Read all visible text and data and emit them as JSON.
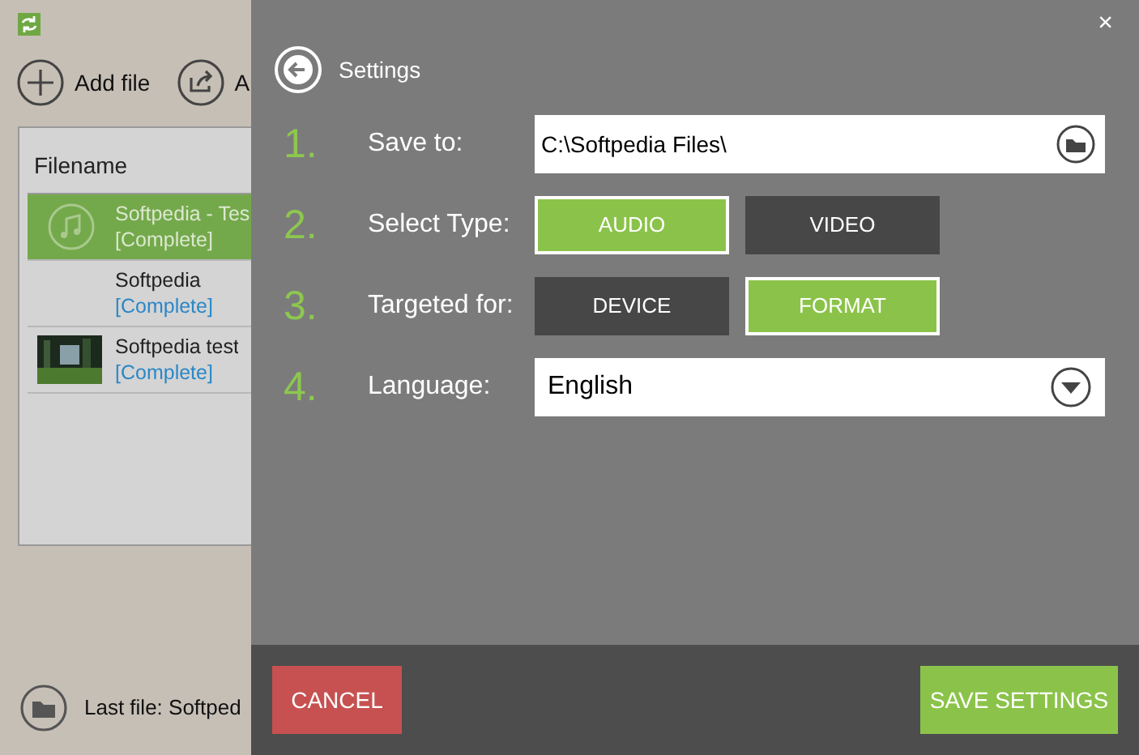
{
  "toolbar": {
    "add_file": "Add file",
    "second_action": "A"
  },
  "file_list": {
    "column": "Filename",
    "rows": [
      {
        "name": "Softpedia - Tes",
        "status": "[Complete]",
        "selected": true,
        "kind": "music"
      },
      {
        "name": "Softpedia",
        "status": "[Complete]",
        "selected": false,
        "kind": "blank"
      },
      {
        "name": "Softpedia test",
        "status": "[Complete]",
        "selected": false,
        "kind": "picture"
      }
    ]
  },
  "last_file": "Last file: Softped",
  "close": "×",
  "settings": {
    "title": "Settings",
    "save_to": {
      "number": "1.",
      "label": "Save to:",
      "value": "C:\\Softpedia Files\\"
    },
    "select_type": {
      "number": "2.",
      "label": "Select Type:",
      "options": [
        {
          "label": "AUDIO",
          "selected": true
        },
        {
          "label": "VIDEO",
          "selected": false
        }
      ]
    },
    "targeted_for": {
      "number": "3.",
      "label": "Targeted for:",
      "options": [
        {
          "label": "DEVICE",
          "selected": false
        },
        {
          "label": "FORMAT",
          "selected": true
        }
      ]
    },
    "language": {
      "number": "4.",
      "label": "Language:",
      "value": "English"
    }
  },
  "buttons": {
    "cancel": "CANCEL",
    "save": "SAVE SETTINGS"
  }
}
